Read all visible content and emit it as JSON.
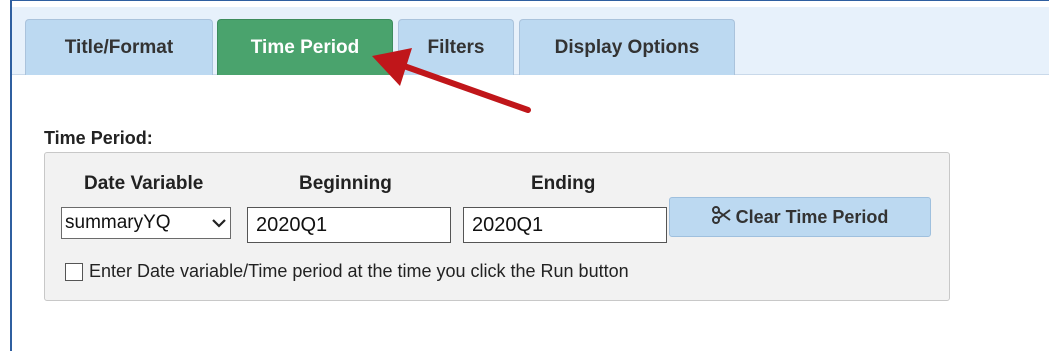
{
  "tabs": [
    {
      "label": "Title/Format",
      "active": false
    },
    {
      "label": "Time Period",
      "active": true
    },
    {
      "label": "Filters",
      "active": false
    },
    {
      "label": "Display Options",
      "active": false
    }
  ],
  "time_period": {
    "section_label": "Time Period:",
    "headers": {
      "date_variable": "Date Variable",
      "beginning": "Beginning",
      "ending": "Ending"
    },
    "date_variable_selected": "summaryYQ",
    "beginning_value": "2020Q1",
    "ending_value": "2020Q1",
    "clear_button_label": "Clear Time Period",
    "checkbox_label": "Enter Date variable/Time period at the time you click the Run button",
    "checkbox_checked": false
  },
  "icons": {
    "clear": "scissors-icon",
    "dropdown": "chevron-down-icon"
  },
  "colors": {
    "tab_active": "#4aa36d",
    "tab_inactive": "#bcd9f1",
    "annotation_arrow": "#c0161a",
    "frame_border": "#2f5fa0"
  }
}
